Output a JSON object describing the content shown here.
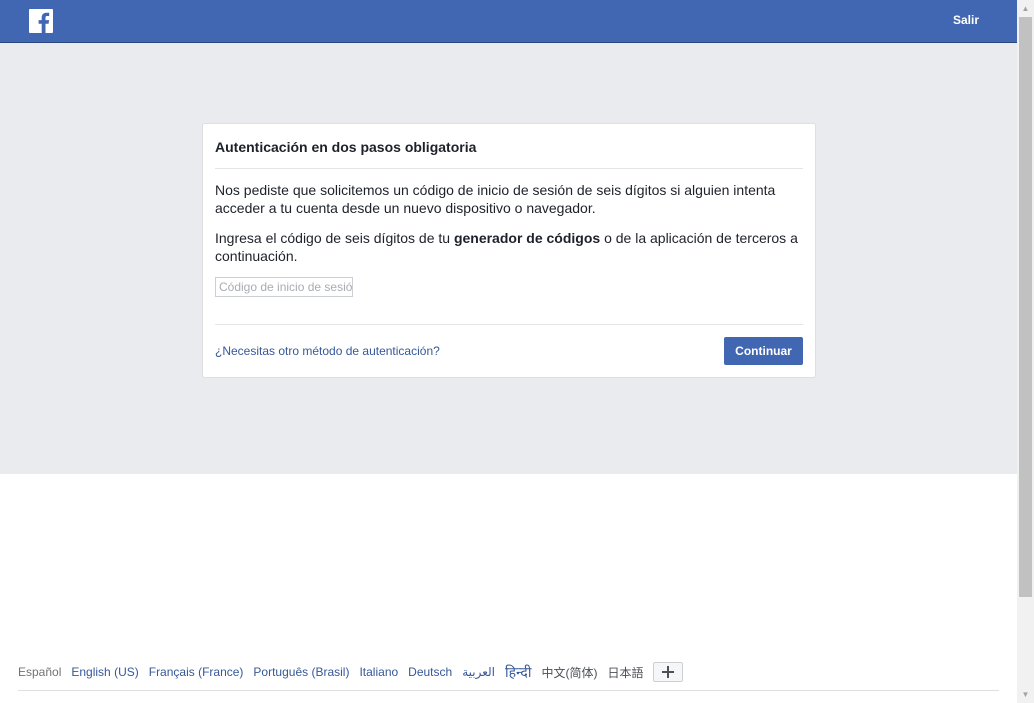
{
  "header": {
    "logo_icon": "facebook-f-icon",
    "logout_label": "Salir"
  },
  "card": {
    "title": "Autenticación en dos pasos obligatoria",
    "paragraph1": "Nos pediste que solicitemos un código de inicio de sesión de seis dígitos si alguien intenta acceder a tu cuenta desde un nuevo dispositivo o navegador.",
    "paragraph2_before": "Ingresa el código de seis dígitos de tu ",
    "paragraph2_bold": "generador de códigos",
    "paragraph2_after": " o de la aplicación de terceros a continuación.",
    "code_input": {
      "value": "",
      "placeholder": "Código de inicio de sesión"
    },
    "alt_method_link": "¿Necesitas otro método de autenticación?",
    "continue_label": "Continuar"
  },
  "footer": {
    "languages": [
      "Español",
      "English (US)",
      "Français (France)",
      "Português (Brasil)",
      "Italiano",
      "Deutsch",
      "العربية",
      "हिन्दी",
      "中文(简体)",
      "日本語"
    ],
    "add_language_icon": "plus-icon"
  },
  "colors": {
    "brand_blue": "#4267b2",
    "link_blue": "#365899",
    "page_gray": "#e9ebee"
  }
}
